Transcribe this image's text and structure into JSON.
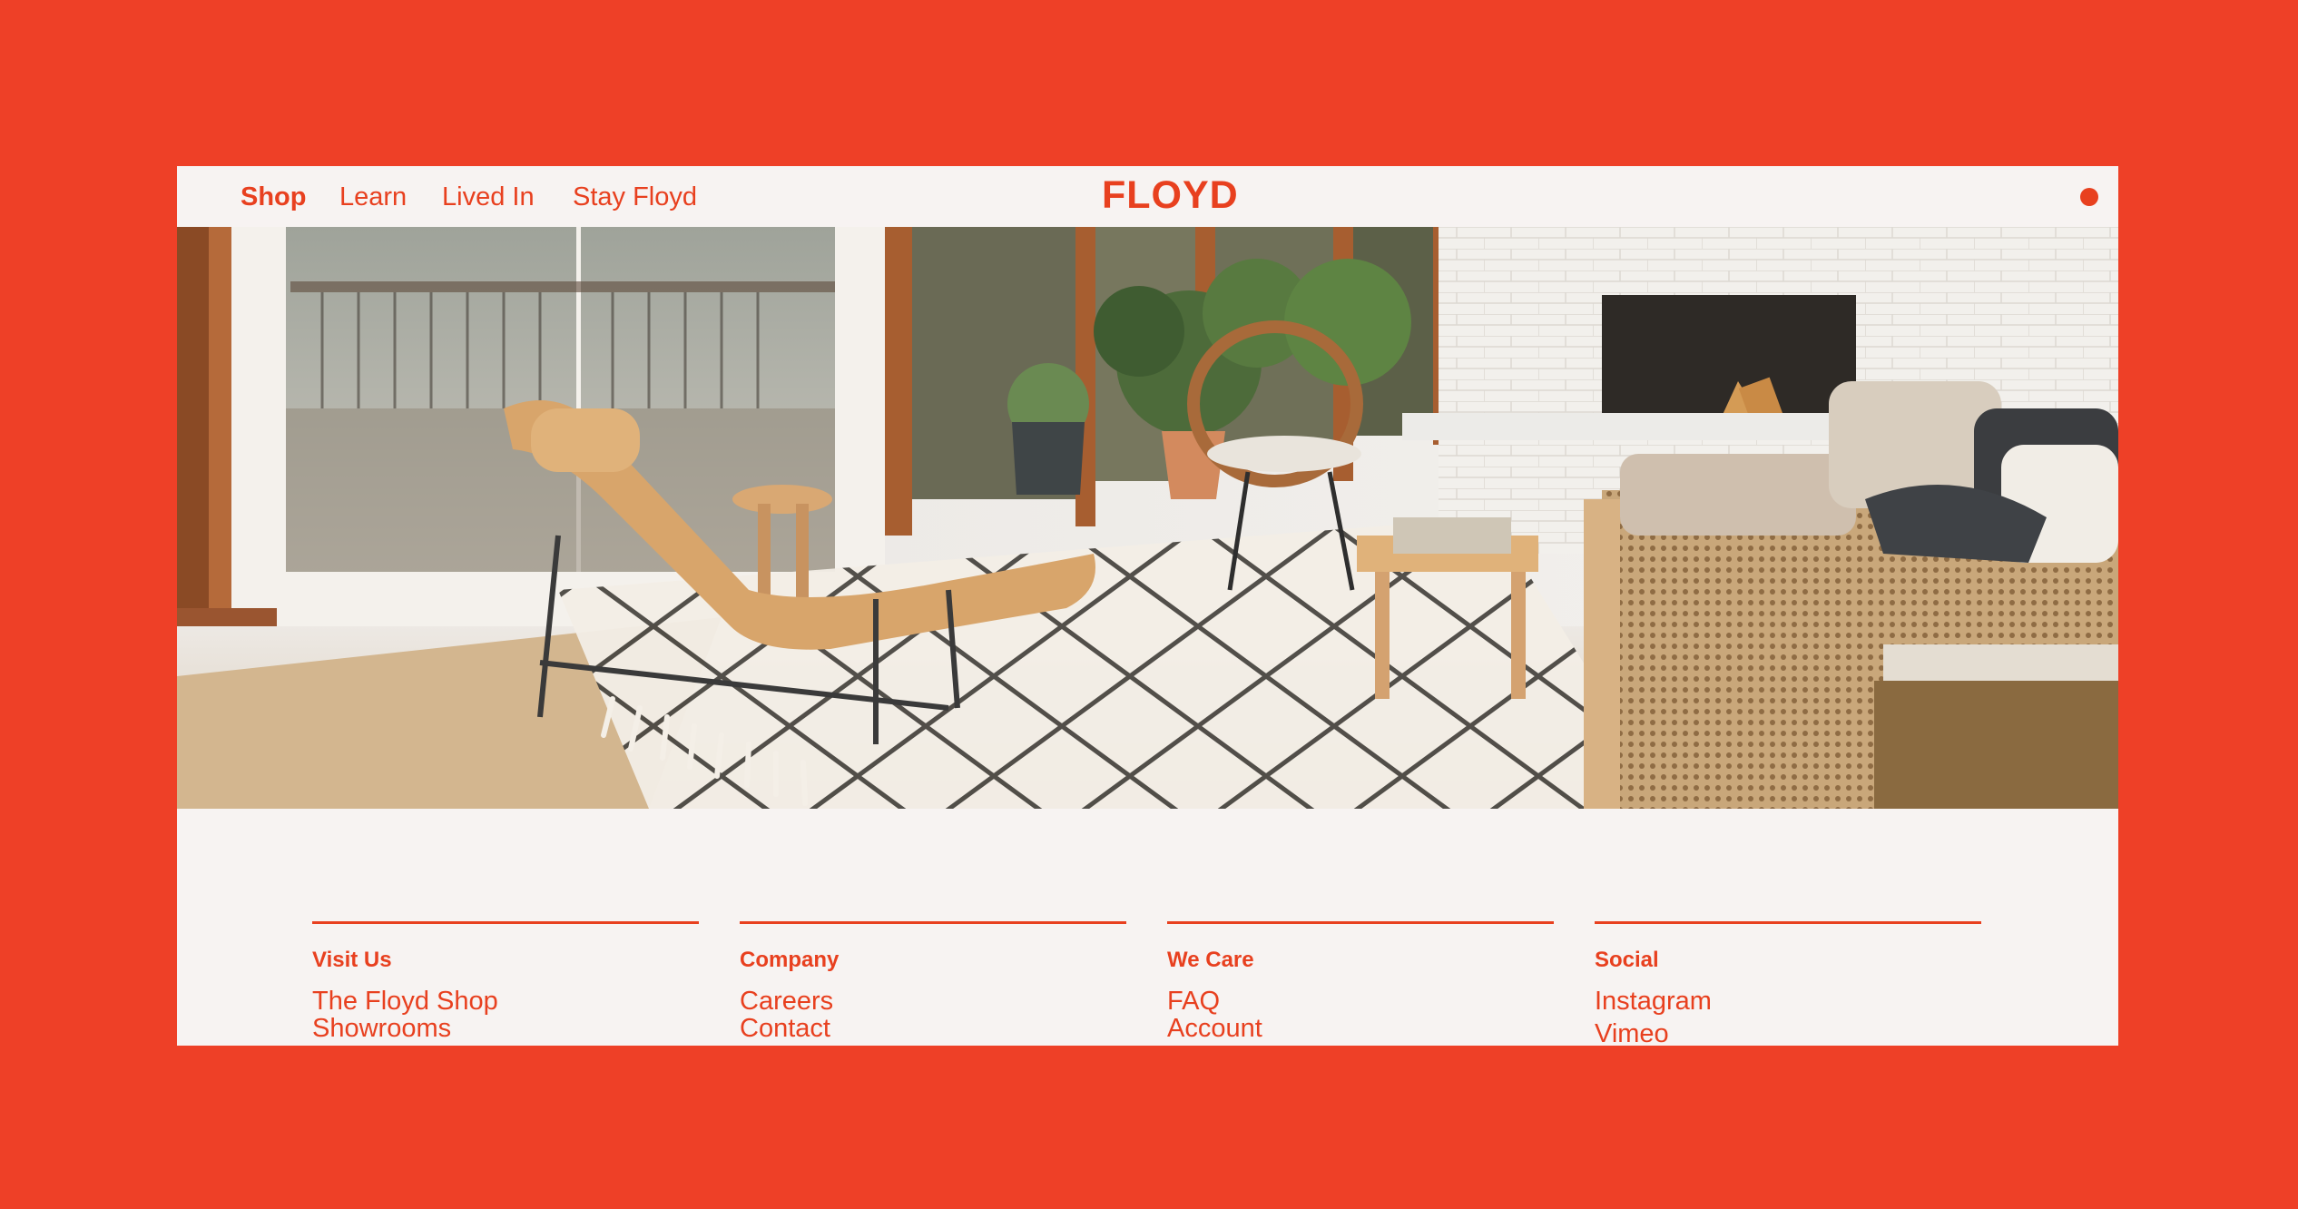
{
  "nav": {
    "items": [
      {
        "label": "Shop",
        "active": true
      },
      {
        "label": "Learn",
        "active": false
      },
      {
        "label": "Lived In",
        "active": false
      },
      {
        "label": "Stay Floyd",
        "active": false
      }
    ],
    "logo": "FLOYD"
  },
  "colors": {
    "background": "#ee4027",
    "panel": "#f7f3f2",
    "accent": "#e8401f"
  },
  "hero": {
    "image": "living-room-photo"
  },
  "footer": {
    "columns": [
      {
        "heading": "Visit Us",
        "links": [
          "The Floyd Shop",
          "Showrooms"
        ]
      },
      {
        "heading": "Company",
        "links": [
          "Careers",
          "Contact"
        ]
      },
      {
        "heading": "We Care",
        "links": [
          "FAQ",
          "Account"
        ]
      },
      {
        "heading": "Social",
        "links": [
          "Instagram",
          "Vimeo"
        ]
      }
    ]
  }
}
